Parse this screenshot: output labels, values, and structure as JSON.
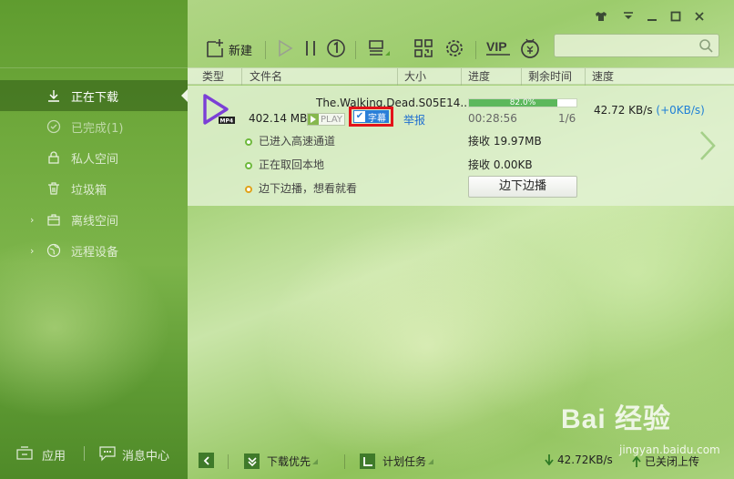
{
  "sidebar": {
    "items": [
      {
        "label": "正在下载",
        "icon": "download-icon"
      },
      {
        "label": "已完成(1)",
        "icon": "check-circle-icon"
      },
      {
        "label": "私人空间",
        "icon": "lock-icon"
      },
      {
        "label": "垃圾箱",
        "icon": "trash-icon"
      },
      {
        "label": "离线空间",
        "icon": "cloud-box-icon"
      },
      {
        "label": "远程设备",
        "icon": "globe-icon"
      }
    ],
    "bottom": {
      "apps_label": "应用",
      "messages_label": "消息中心"
    }
  },
  "toolbar": {
    "new_label": "新建",
    "search_placeholder": ""
  },
  "columns": [
    "类型",
    "文件名",
    "大小",
    "进度",
    "剩余时间",
    "速度"
  ],
  "task": {
    "filename": "The.Walking.Dead.S05E14...",
    "size": "402.14 MB",
    "play_label": "PLAY",
    "subtitle_label": "字幕",
    "report_label": "举报",
    "progress_percent": 82.0,
    "progress_text": "82.0%",
    "remaining_time": "00:28:56",
    "part": "1/6",
    "speed": "42.72  KB/s",
    "speed_extra": "(+0KB/s)",
    "status_lines": [
      {
        "text": "已进入高速通道",
        "recv": "接收 19.97MB",
        "dot": "green"
      },
      {
        "text": "正在取回本地",
        "recv": "接收 0.00KB",
        "dot": "green"
      },
      {
        "text": "边下边播，想看就看",
        "recv": "",
        "dot": "orange"
      }
    ],
    "edge_play_button": "边下边播",
    "file_type": "MP4"
  },
  "statusbar": {
    "priority_label": "下载优先",
    "schedule_label": "计划任务",
    "total_speed": "42.72KB/s",
    "upload_label": "已关闭上传"
  },
  "watermark": {
    "logo_text": "Bai 经验",
    "url": "jingyan.baidu.com"
  },
  "colors": {
    "accent_green": "#5cb85c",
    "highlight_red": "#e3131a",
    "link_blue": "#1f6fd0"
  }
}
